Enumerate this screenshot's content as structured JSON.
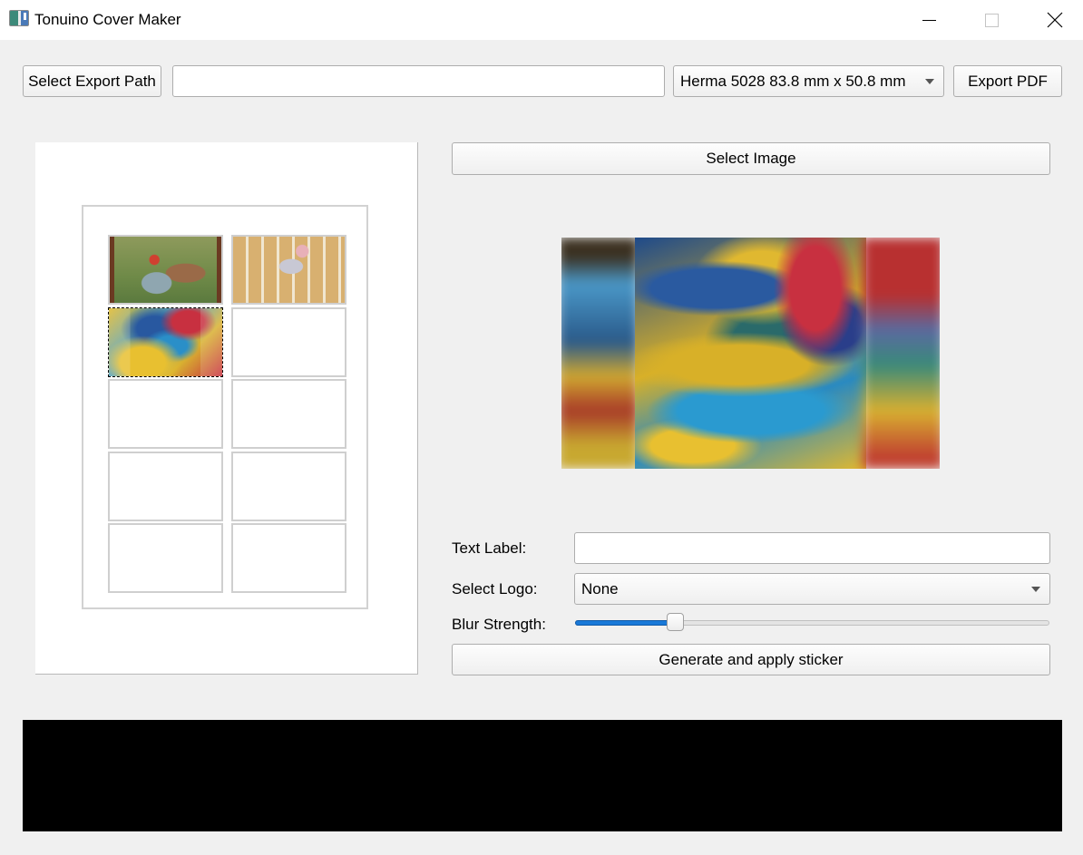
{
  "window": {
    "title": "Tonuino Cover Maker",
    "controls": [
      "minimize",
      "maximize",
      "close"
    ]
  },
  "toolbar": {
    "select_export_path_label": "Select Export Path",
    "export_path_value": "",
    "label_format_selected": "Herma 5028 83.8 mm x 50.8 mm",
    "export_pdf_label": "Export PDF"
  },
  "sheet_preview": {
    "columns": 2,
    "rows": 5,
    "cells": [
      {
        "index": 0,
        "content": "red-riding-hood-image",
        "selected": false
      },
      {
        "index": 1,
        "content": "mouse-pantry-image",
        "selected": false
      },
      {
        "index": 2,
        "content": "colorful-swirl-image",
        "selected": true
      },
      {
        "index": 3,
        "content": "empty",
        "selected": false
      },
      {
        "index": 4,
        "content": "empty",
        "selected": false
      },
      {
        "index": 5,
        "content": "empty",
        "selected": false
      },
      {
        "index": 6,
        "content": "empty",
        "selected": false
      },
      {
        "index": 7,
        "content": "empty",
        "selected": false
      },
      {
        "index": 8,
        "content": "empty",
        "selected": false
      },
      {
        "index": 9,
        "content": "empty",
        "selected": false
      }
    ]
  },
  "editor": {
    "select_image_label": "Select Image",
    "preview_image": "colorful-swirl-image",
    "text_label_label": "Text Label:",
    "text_label_value": "",
    "select_logo_label": "Select Logo:",
    "select_logo_selected": "None",
    "blur_strength_label": "Blur Strength:",
    "blur_strength_fraction": 0.21,
    "generate_label": "Generate and apply sticker"
  },
  "colors": {
    "accent": "#1979d8",
    "background": "#f0f0f0",
    "console_background": "#000000"
  },
  "console": {
    "text": ""
  }
}
